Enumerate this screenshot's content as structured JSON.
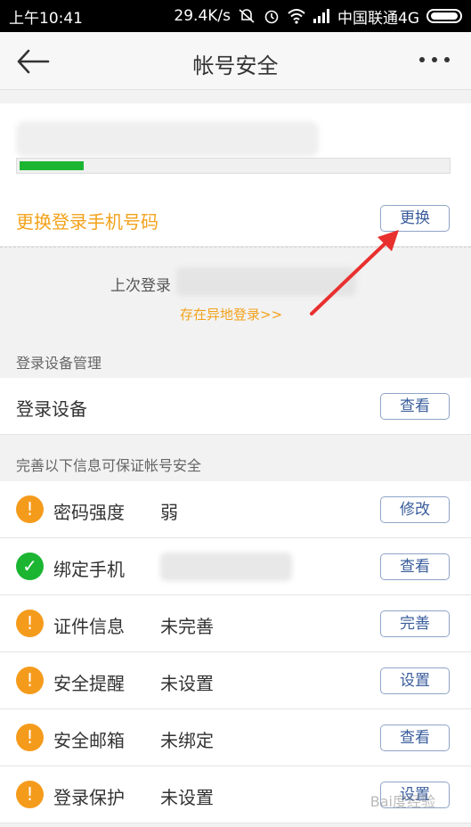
{
  "status_bar": {
    "time": "上午10:41",
    "network_speed": "29.4K/s",
    "carrier": "中国联通4G",
    "icons": [
      "mute-icon",
      "alarm-icon",
      "wifi-icon",
      "signal-icon",
      "battery-icon"
    ]
  },
  "header": {
    "title": "帐号安全",
    "back_icon": "back-arrow-icon",
    "more_icon": "more-dots-icon"
  },
  "account": {
    "security_level_fraction": 0.15,
    "security_level_color": "#1bb532"
  },
  "change_phone": {
    "label": "更换登录手机号码",
    "button": "更换"
  },
  "last_login": {
    "label": "上次登录",
    "abnormal_link": "存在异地登录>>"
  },
  "device_section": {
    "title": "登录设备管理",
    "row_label": "登录设备",
    "button": "查看"
  },
  "security_section": {
    "title": "完善以下信息可保证帐号安全",
    "items": [
      {
        "label": "密码强度",
        "value": "弱",
        "button": "修改",
        "status": "warning",
        "icon": "!"
      },
      {
        "label": "绑定手机",
        "value": "",
        "button": "查看",
        "status": "ok",
        "icon": "✓"
      },
      {
        "label": "证件信息",
        "value": "未完善",
        "button": "完善",
        "status": "warning",
        "icon": "!"
      },
      {
        "label": "安全提醒",
        "value": "未设置",
        "button": "设置",
        "status": "warning",
        "icon": "!"
      },
      {
        "label": "安全邮箱",
        "value": "未绑定",
        "button": "查看",
        "status": "warning",
        "icon": "!"
      },
      {
        "label": "登录保护",
        "value": "未设置",
        "button": "设置",
        "status": "warning",
        "icon": "!"
      }
    ]
  },
  "colors": {
    "accent_orange": "#f3a21b",
    "warning": "#f59b1c",
    "ok": "#1bb532",
    "button_text": "#3a5d9c",
    "annotation_arrow": "#e8302f"
  },
  "watermark": "Bai度经验"
}
